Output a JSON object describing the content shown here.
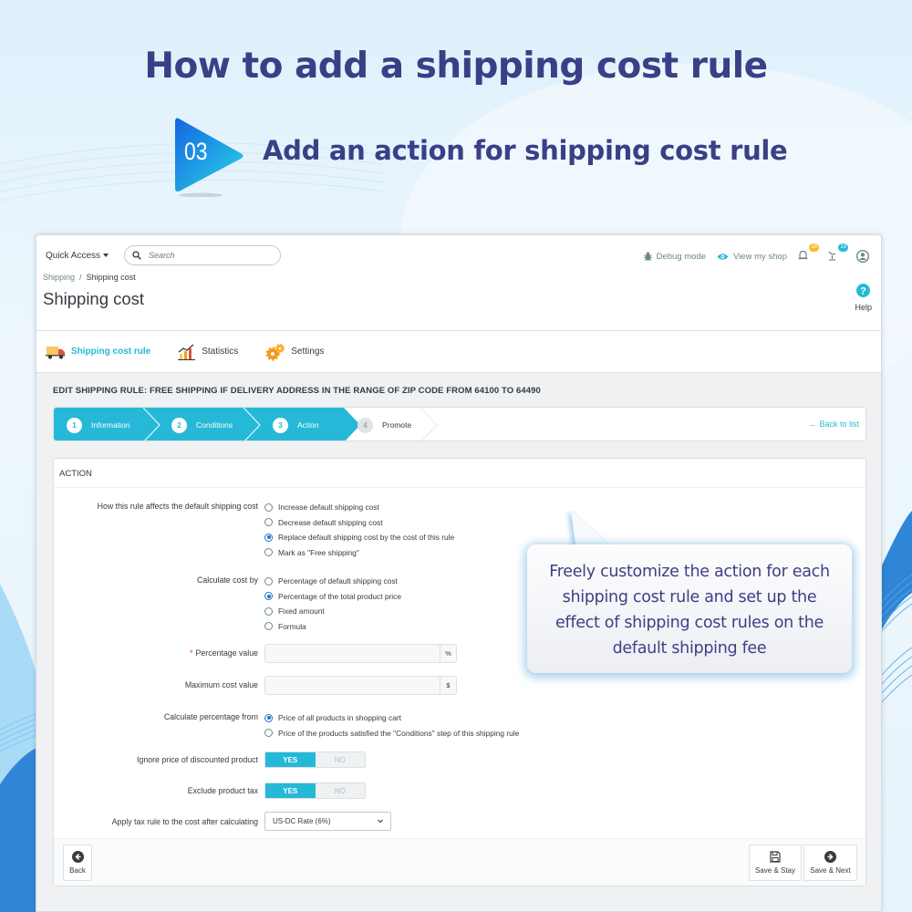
{
  "hero": {
    "title": "How to add a shipping cost rule",
    "step_number": "03",
    "step_title": "Add an action for shipping cost rule"
  },
  "header": {
    "quick_access": "Quick Access",
    "search_placeholder": "Search",
    "debug_mode": "Debug mode",
    "view_shop": "View my shop",
    "notifications_orders": "28",
    "notifications_customers": "19",
    "help": "Help"
  },
  "breadcrumb": {
    "parent": "Shipping",
    "separator": "/",
    "current": "Shipping cost"
  },
  "page_title": "Shipping cost",
  "tabs": [
    {
      "label": "Shipping cost rule",
      "icon": "truck-icon",
      "active": true
    },
    {
      "label": "Statistics",
      "icon": "chart-icon",
      "active": false
    },
    {
      "label": "Settings",
      "icon": "gears-icon",
      "active": false
    }
  ],
  "edit_title": "EDIT SHIPPING RULE: FREE SHIPPING IF DELIVERY ADDRESS IN THE RANGE OF ZIP CODE FROM 64100 TO 64490",
  "wizard": {
    "steps": [
      {
        "num": "1",
        "label": "Information",
        "state": "done"
      },
      {
        "num": "2",
        "label": "Conditions",
        "state": "done"
      },
      {
        "num": "3",
        "label": "Action",
        "state": "current"
      },
      {
        "num": "4",
        "label": "Promote",
        "state": "pending"
      }
    ],
    "back_to_list": "Back to list"
  },
  "form": {
    "panel_title": "ACTION",
    "affects": {
      "label": "How this rule affects the default shipping cost",
      "options": [
        {
          "label": "Increase default shipping cost",
          "checked": false
        },
        {
          "label": "Decrease default shipping cost",
          "checked": false
        },
        {
          "label": "Replace default shipping cost by the cost of this rule",
          "checked": true
        },
        {
          "label": "Mark as \"Free shipping\"",
          "checked": false
        }
      ]
    },
    "calc_by": {
      "label": "Calculate cost by",
      "options": [
        {
          "label": "Percentage of default shipping cost",
          "checked": false
        },
        {
          "label": "Percentage of the total product price",
          "checked": true
        },
        {
          "label": "Fixed amount",
          "checked": false
        },
        {
          "label": "Formula",
          "checked": false
        }
      ]
    },
    "percentage_value": {
      "label": "Percentage value",
      "required_mark": "*",
      "value": "",
      "suffix": "%"
    },
    "max_cost": {
      "label": "Maximum cost value",
      "value": "",
      "suffix": "$"
    },
    "calc_from": {
      "label": "Calculate percentage from",
      "options": [
        {
          "label": "Price of all products in shopping cart",
          "checked": true
        },
        {
          "label": "Price of the products satisfied the \"Conditions\" step of this shipping rule",
          "checked": false
        }
      ]
    },
    "ignore_discounted": {
      "label": "Ignore price of discounted product",
      "yes": "YES",
      "no": "NO",
      "value": "YES"
    },
    "exclude_tax": {
      "label": "Exclude product tax",
      "yes": "YES",
      "no": "NO",
      "value": "YES"
    },
    "tax_rule": {
      "label": "Apply tax rule to the cost after calculating",
      "selected": "US-DC Rate (6%)"
    }
  },
  "footer": {
    "back": "Back",
    "save_stay": "Save & Stay",
    "save_next": "Save & Next"
  },
  "tooltip": {
    "text": "Freely customize the action for each shipping cost rule and set up the effect of shipping cost rules on the default shipping fee"
  },
  "colors": {
    "accent": "#25b9d7",
    "hero_text": "#3a3f86",
    "radio_checked": "#1d74c9",
    "required": "#e0301e"
  }
}
